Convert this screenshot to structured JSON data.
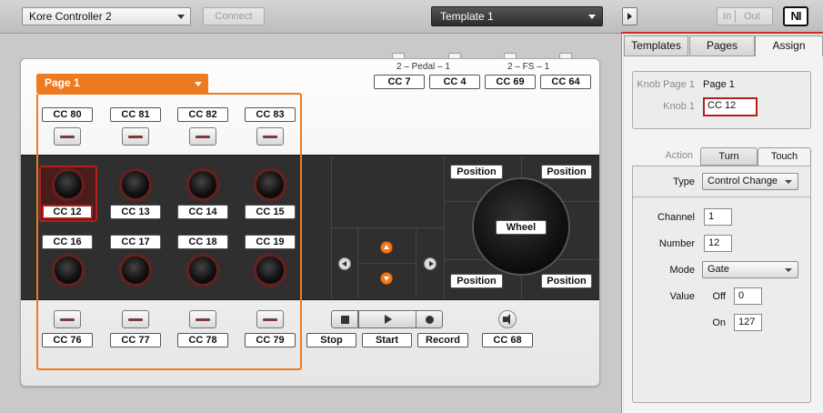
{
  "topbar": {
    "controller": "Kore Controller 2",
    "connect": "Connect",
    "template": "Template 1",
    "in": "In",
    "out": "Out",
    "logo": "NI"
  },
  "page": {
    "selector": "Page 1"
  },
  "pedal_group": "2 – Pedal – 1",
  "fs_group": "2 – FS – 1",
  "pedal_labels": [
    "CC 7",
    "CC 4",
    "CC 69",
    "CC 64"
  ],
  "top_buttons": [
    "CC 80",
    "CC 81",
    "CC 82",
    "CC 83"
  ],
  "knobs_row1": [
    "CC 12",
    "CC 13",
    "CC 14",
    "CC 15"
  ],
  "knobs_row2": [
    "CC 16",
    "CC 17",
    "CC 18",
    "CC 19"
  ],
  "bottom_buttons": [
    "CC 76",
    "CC 77",
    "CC 78",
    "CC 79"
  ],
  "transport": {
    "stop": "Stop",
    "start": "Start",
    "record": "Record",
    "volume": "CC 68"
  },
  "wheel": {
    "label": "Wheel",
    "pos_tl": "Position",
    "pos_tr": "Position",
    "pos_bl": "Position",
    "pos_br": "Position"
  },
  "right": {
    "tabs": [
      "Templates",
      "Pages",
      "Assign"
    ],
    "knob_page_label": "Knob Page 1",
    "knob_page_value": "Page 1",
    "knob_label": "Knob 1",
    "knob_value": "CC 12",
    "action_label": "Action",
    "subtabs": [
      "Turn",
      "Touch"
    ],
    "type_label": "Type",
    "type_value": "Control Change",
    "channel_label": "Channel",
    "channel_value": "1",
    "number_label": "Number",
    "number_value": "12",
    "mode_label": "Mode",
    "mode_value": "Gate",
    "value_label": "Value",
    "off_label": "Off",
    "off_value": "0",
    "on_label": "On",
    "on_value": "127"
  },
  "colors": {
    "accent": "#f07a1f",
    "selection": "#b0211e",
    "dark_panel": "#2f2f2f"
  }
}
